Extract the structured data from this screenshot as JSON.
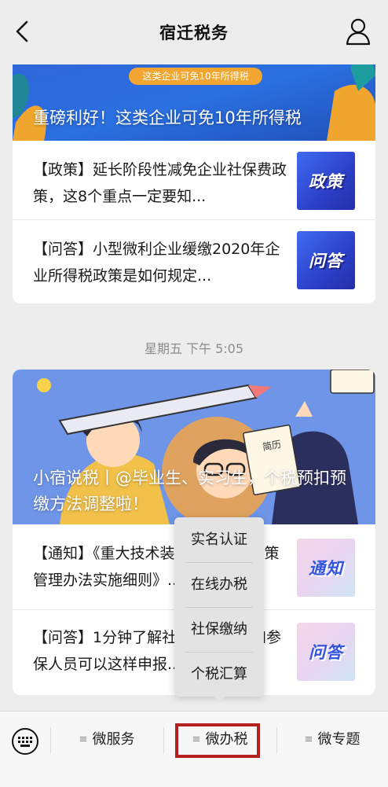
{
  "header": {
    "title": "宿迁税务"
  },
  "card1": {
    "banner_top_text": "这类企业可免10年所得税",
    "caption": "重磅利好！这类企业可免10年所得税",
    "items": [
      {
        "text": "【政策】延长阶段性减免企业社保费政策，这8个重点一定要知...",
        "thumb_label": "政策"
      },
      {
        "text": "【问答】小型微利企业缓缴2020年企业所得税政策是如何规定...",
        "thumb_label": "问答"
      }
    ]
  },
  "timestamp": "星期五 下午 5:05",
  "card2": {
    "caption": "小宿说税丨@毕业生、实习生，个税预扣预缴方法调整啦！",
    "paper_label": "简历",
    "items": [
      {
        "text": "【通知】《重大技术装备进口税收政策管理办法实施细则》...",
        "thumb_label": "通知"
      },
      {
        "text": "【问答】1分钟了解社保缴费单位和参保人员可以这样申报...",
        "thumb_label": "问答"
      }
    ]
  },
  "popup_menu": {
    "items": [
      "实名认证",
      "在线办税",
      "社保缴纳",
      "个税汇算"
    ]
  },
  "bottom_tabs": [
    "微服务",
    "微办税",
    "微专题"
  ],
  "colors": {
    "highlight": "#b3201e",
    "background": "#ededed"
  }
}
